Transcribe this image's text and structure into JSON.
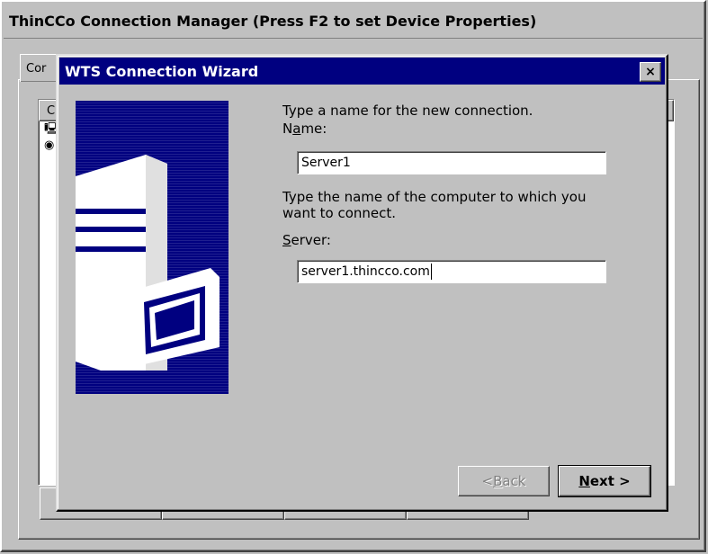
{
  "window": {
    "title": "ThinCCo Connection Manager (Press F2 to set Device Properties)"
  },
  "background": {
    "tab_label": "Cor",
    "list_header": "C"
  },
  "dialog": {
    "title": "WTS Connection Wizard",
    "close_label": "×",
    "name_prompt": "Type a name for the new connection.",
    "name_label_pre": "N",
    "name_label_access": "a",
    "name_label_post": "me:",
    "name_value": "Server1",
    "server_prompt_line1": "Type the name of the computer to which you",
    "server_prompt_line2": "want to connect.",
    "server_label_access": "S",
    "server_label_post": "erver:",
    "server_value": "server1.thincco.com",
    "back_label_pre": "< ",
    "back_label_access": "B",
    "back_label_post": "ack",
    "next_label_access": "N",
    "next_label_post": "ext >"
  },
  "icons": {
    "art": "server-computer-illustration",
    "list_icon_1": "computer-icon",
    "list_icon_2": "globe-icon"
  },
  "colors": {
    "title_bar": "#000080",
    "face": "#c0c0c0"
  }
}
